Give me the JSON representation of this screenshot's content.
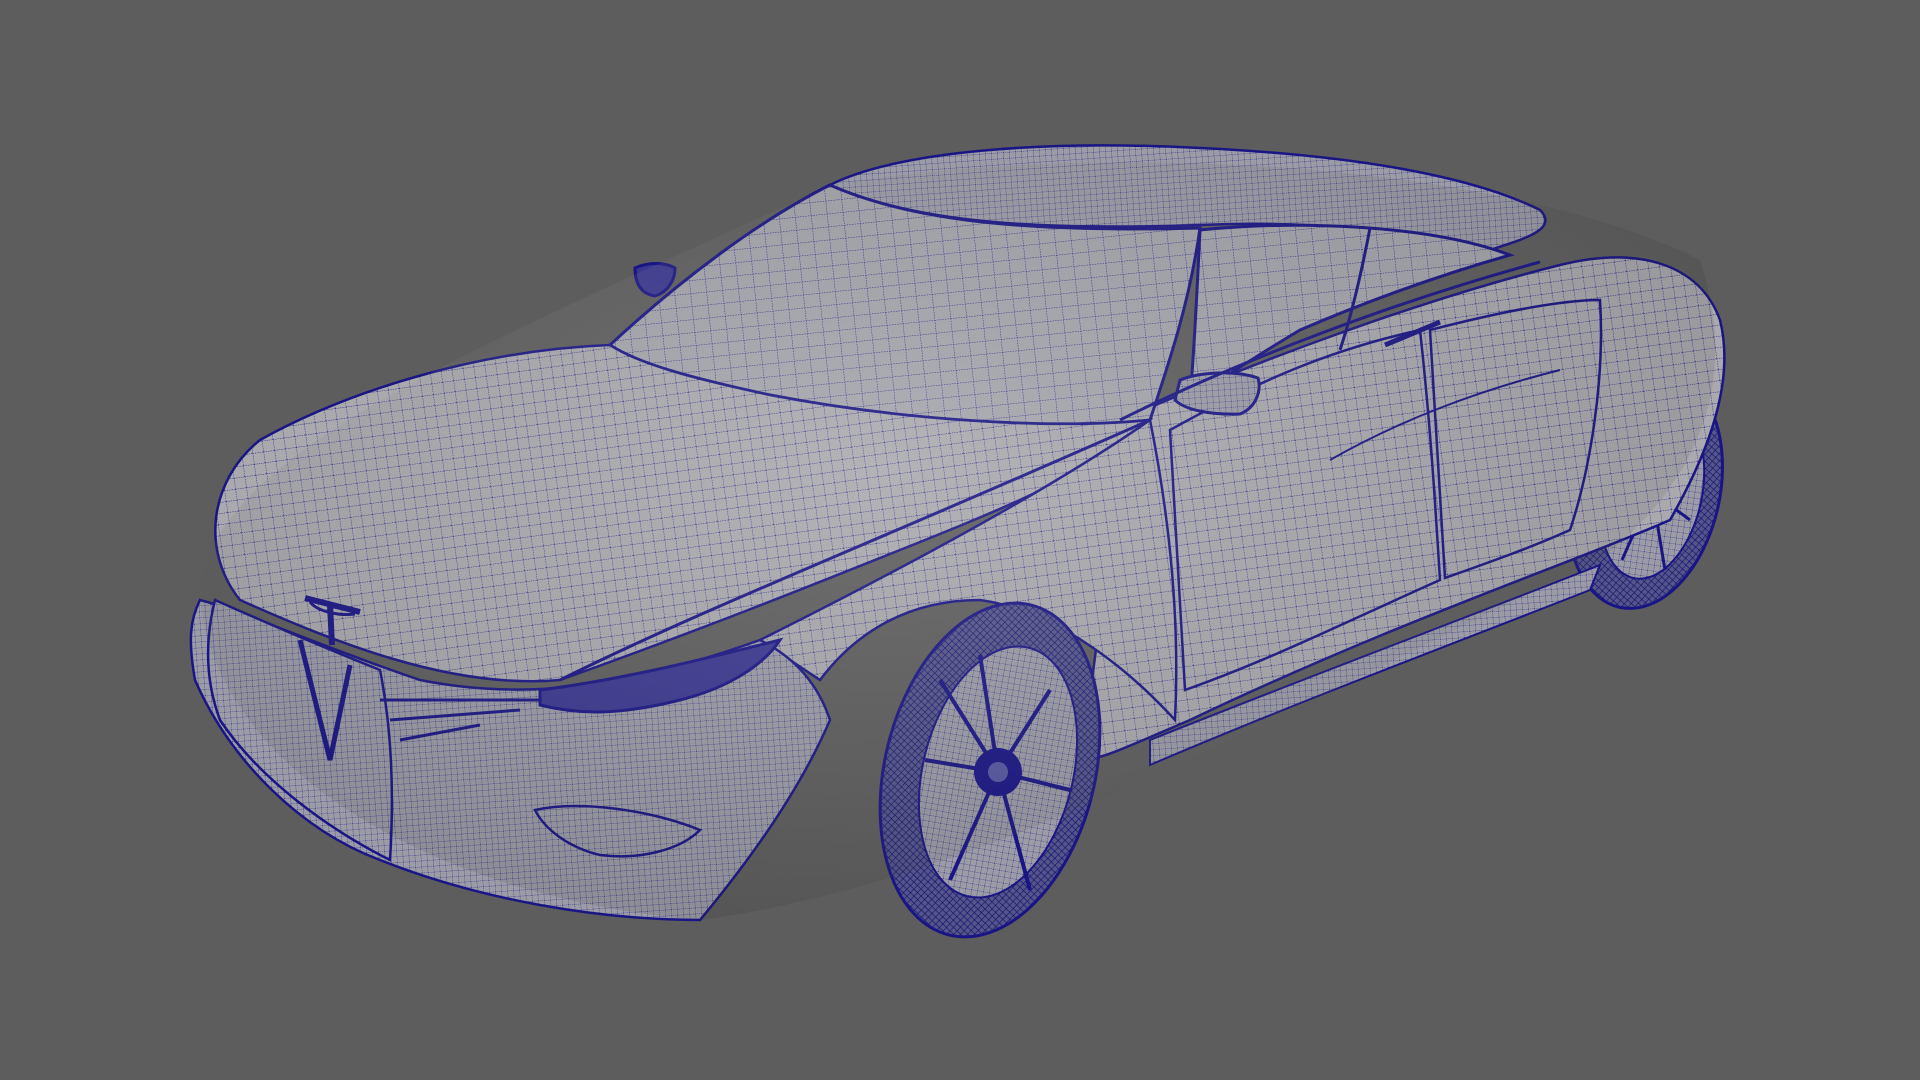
{
  "viewport": {
    "background_color": "#5d5d5d",
    "display_mode": "wireframe-on-shaded",
    "shaded_color": "#a9a9ae",
    "wire_color": "#1a1585"
  },
  "scene": {
    "object": "car-model",
    "emblem": "tesla-logo-icon"
  }
}
